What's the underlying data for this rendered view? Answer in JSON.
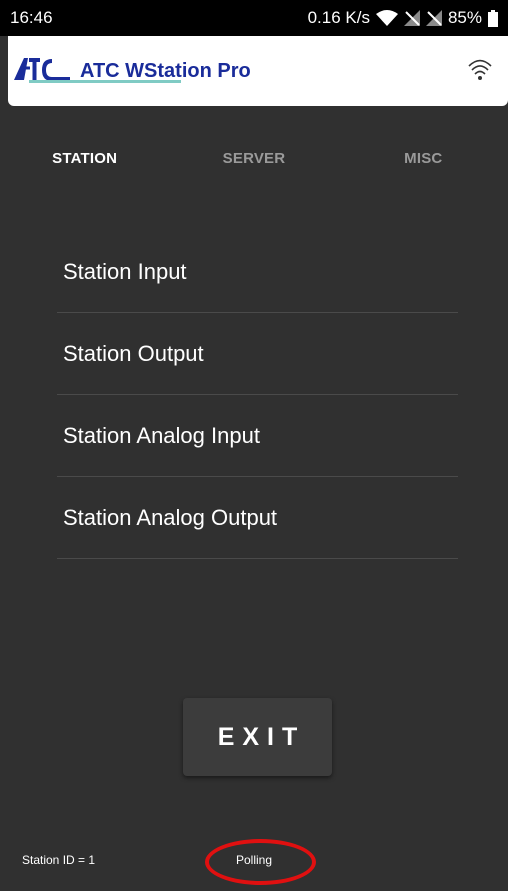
{
  "status_bar": {
    "time": "16:46",
    "network_speed": "0.16 K/s",
    "battery": "85%",
    "icons": [
      "wifi-icon",
      "no-signal-icon",
      "no-signal-icon",
      "battery-icon"
    ]
  },
  "header": {
    "logo_text": "ATC",
    "title": "ATC WStation Pro",
    "icons": [
      "atc-logo-icon",
      "wifi-icon"
    ],
    "colors": {
      "title": "#1a2c9a",
      "background": "#ffffff"
    }
  },
  "tabs": [
    {
      "label": "STATION",
      "active": true
    },
    {
      "label": "SERVER",
      "active": false
    },
    {
      "label": "MISC",
      "active": false
    }
  ],
  "menu": {
    "items": [
      {
        "label": "Station Input"
      },
      {
        "label": "Station Output"
      },
      {
        "label": "Station Analog Input"
      },
      {
        "label": "Station Analog Output"
      }
    ]
  },
  "exit_button": {
    "label": "EXIT"
  },
  "footer": {
    "station_id": "Station ID = 1",
    "status": "Polling"
  },
  "colors": {
    "background": "#303030",
    "tab_indicator": "#80cbc4",
    "annotation_ring": "#e01010"
  }
}
